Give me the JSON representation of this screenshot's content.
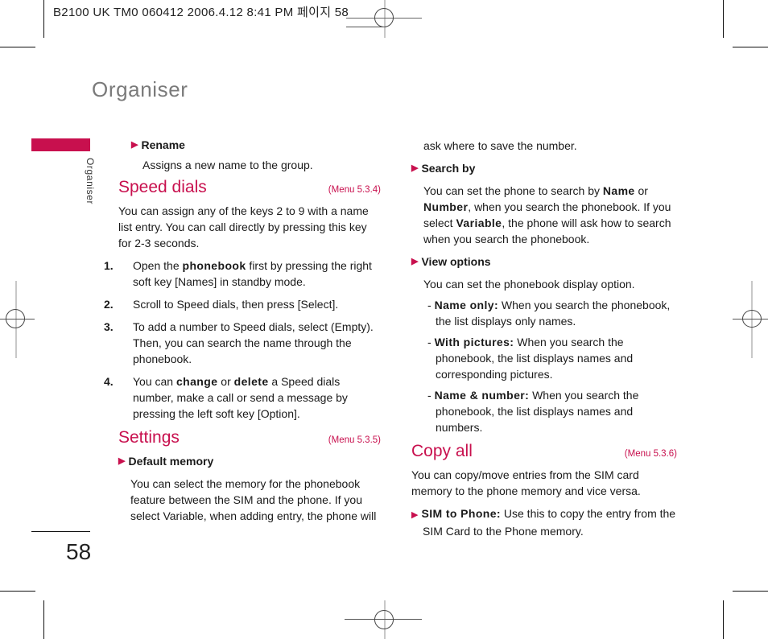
{
  "print_header": "B2100 UK TM0 060412 2006.4.12 8:41 PM 페이지 58",
  "chapter_title": "Organiser",
  "side_tab_label": "Organiser",
  "page_number": "58",
  "colors": {
    "accent": "#c8104e",
    "title_gray": "#7a7a7a"
  },
  "left_column": {
    "rename": {
      "heading": "Rename",
      "text": "Assigns a new name to the group."
    },
    "speed_dials": {
      "title": "Speed dials",
      "menu_ref": "(Menu 5.3.4)",
      "intro": "You can assign any of the keys 2 to 9 with a name list entry. You can call directly by pressing this key for 2-3 seconds.",
      "steps": [
        {
          "num": "1.",
          "pre": "Open the ",
          "kw": "phonebook",
          "post": " first by pressing the right soft key [Names] in standby mode."
        },
        {
          "num": "2.",
          "text": "Scroll to Speed dials, then press [Select]."
        },
        {
          "num": "3.",
          "text": "To add a number to Speed dials, select (Empty). Then, you can search the name through the phonebook."
        },
        {
          "num": "4.",
          "pre": "You can ",
          "kw1": "change",
          "mid": " or ",
          "kw2": "delete",
          "post": " a Speed dials number, make a call or send a message by pressing the left soft key [Option]."
        }
      ]
    },
    "settings": {
      "title": "Settings",
      "menu_ref": "(Menu 5.3.5)",
      "default_memory_heading": "Default memory",
      "default_memory_text": "You can select the memory for the phonebook feature between the SIM and the phone. If you select Variable, when adding entry, the phone will"
    }
  },
  "right_column": {
    "continued_text": "ask where to save the number.",
    "search_by": {
      "heading": "Search by",
      "pre": "You can set the phone to search by ",
      "kw1": "Name",
      "mid1": " or ",
      "kw2": "Number",
      "mid2": ", when you search the phonebook. If you select ",
      "kw3": "Variable",
      "post": ", the phone will ask how to search when you search the phonebook."
    },
    "view_options": {
      "heading": "View options",
      "intro": "You can set the phonebook display option.",
      "items": [
        {
          "label": "Name only:",
          "text": " When you search the phonebook, the list displays only names."
        },
        {
          "label": "With pictures:",
          "text": " When you search the phonebook, the list displays names and corresponding pictures."
        },
        {
          "label": "Name & number:",
          "text": " When you search the phonebook, the list displays names and numbers."
        }
      ]
    },
    "copy_all": {
      "title": "Copy all",
      "menu_ref": "(Menu 5.3.6)",
      "intro": "You can copy/move entries from the SIM card memory to the phone memory and vice versa.",
      "sim_to_phone_label": "SIM to Phone:",
      "sim_to_phone_text": " Use this to copy the entry from the SIM Card to the Phone memory."
    }
  }
}
